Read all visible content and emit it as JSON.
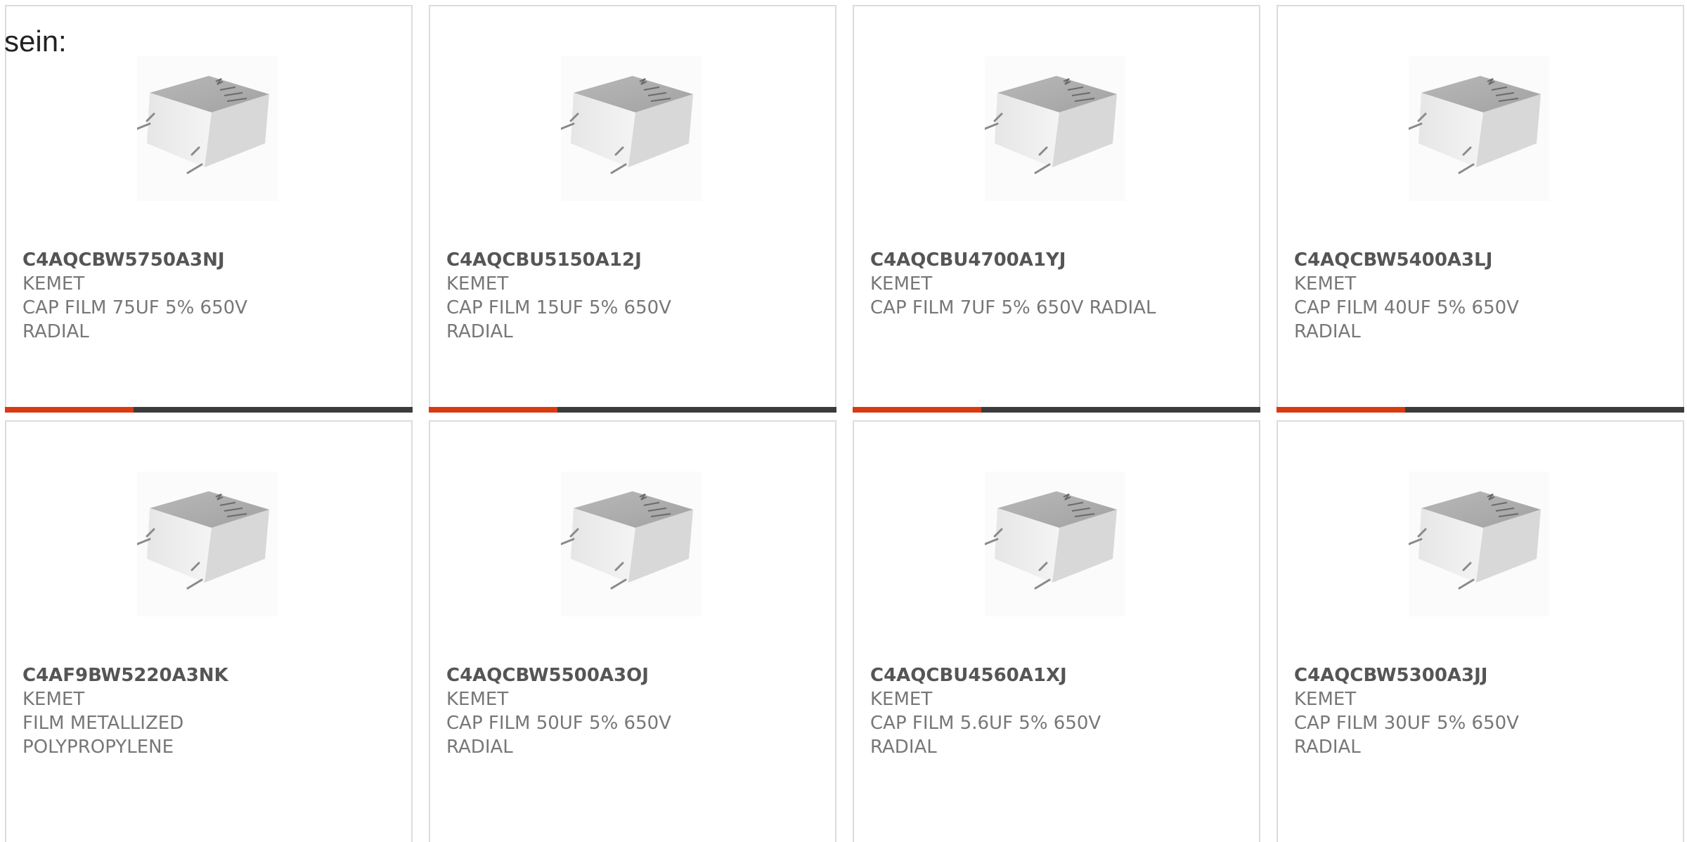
{
  "intro_text": "sein:",
  "accent_color": "#d93a12",
  "bar_color": "#3c3c3c",
  "image_icon": "film-capacitor-image",
  "products": [
    {
      "part_number": "C4AQCBW5750A3NJ",
      "manufacturer": "KEMET",
      "description": "CAP FILM 75UF 5% 650V RADIAL"
    },
    {
      "part_number": "C4AQCBU5150A12J",
      "manufacturer": "KEMET",
      "description": "CAP FILM 15UF 5% 650V RADIAL"
    },
    {
      "part_number": "C4AQCBU4700A1YJ",
      "manufacturer": "KEMET",
      "description": "CAP FILM 7UF 5% 650V RADIAL"
    },
    {
      "part_number": "C4AQCBW5400A3LJ",
      "manufacturer": "KEMET",
      "description": "CAP FILM 40UF 5% 650V RADIAL"
    },
    {
      "part_number": "C4AF9BW5220A3NK",
      "manufacturer": "KEMET",
      "description": "FILM METALLIZED POLYPROPYLENE"
    },
    {
      "part_number": "C4AQCBW5500A3OJ",
      "manufacturer": "KEMET",
      "description": "CAP FILM 50UF 5% 650V RADIAL"
    },
    {
      "part_number": "C4AQCBU4560A1XJ",
      "manufacturer": "KEMET",
      "description": "CAP FILM 5.6UF 5% 650V RADIAL"
    },
    {
      "part_number": "C4AQCBW5300A3JJ",
      "manufacturer": "KEMET",
      "description": "CAP FILM 30UF 5% 650V RADIAL"
    }
  ]
}
